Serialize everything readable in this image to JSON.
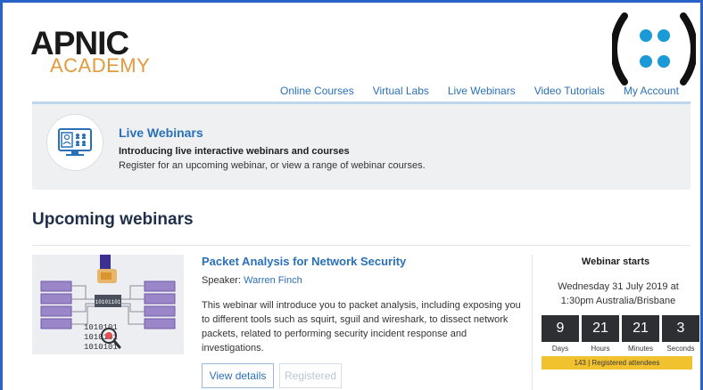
{
  "header": {
    "logo_main_bold": "APNIC",
    "logo_sub": "ACADEMY"
  },
  "nav": {
    "items": [
      {
        "label": "Online Courses"
      },
      {
        "label": "Virtual Labs"
      },
      {
        "label": "Live Webinars"
      },
      {
        "label": "Video Tutorials"
      },
      {
        "label": "My Account"
      }
    ]
  },
  "banner": {
    "title": "Live Webinars",
    "subtitle": "Introducing live interactive webinars and courses",
    "description": "Register for an upcoming webinar, or view a range of webinar courses.",
    "icon": "webinar-screen-icon"
  },
  "section": {
    "title": "Upcoming webinars"
  },
  "webinar": {
    "title": "Packet Analysis for Network Security",
    "speaker_label": "Speaker:",
    "speaker_name": "Warren Finch",
    "description": "This webinar will introduce you to packet analysis, including exposing you to different tools such as squirt, sguil and wireshark, to dissect network packets, related to performing security incident response and investigations.",
    "thumb_binary": [
      "1010101",
      "1010101",
      "1010101"
    ],
    "thumb_packet_text": "10101101",
    "buttons": {
      "details": "View details",
      "registered": "Registered"
    }
  },
  "countdown": {
    "heading": "Webinar starts",
    "date_line1": "Wednesday 31 July 2019 at",
    "date_line2": "1:30pm Australia/Brisbane",
    "units": [
      {
        "value": "9",
        "label": "Days"
      },
      {
        "value": "21",
        "label": "Hours"
      },
      {
        "value": "21",
        "label": "Minutes"
      },
      {
        "value": "3",
        "label": "Seconds"
      }
    ],
    "attendees": "143 | Registered attendees"
  },
  "colors": {
    "accent": "#2a70b8",
    "brand_orange": "#e39a3d",
    "brand_dots": "#1a9ad6",
    "countdown_bg": "#2d2f33",
    "attendees_bg": "#f2c12e",
    "frame": "#2a63c6"
  }
}
